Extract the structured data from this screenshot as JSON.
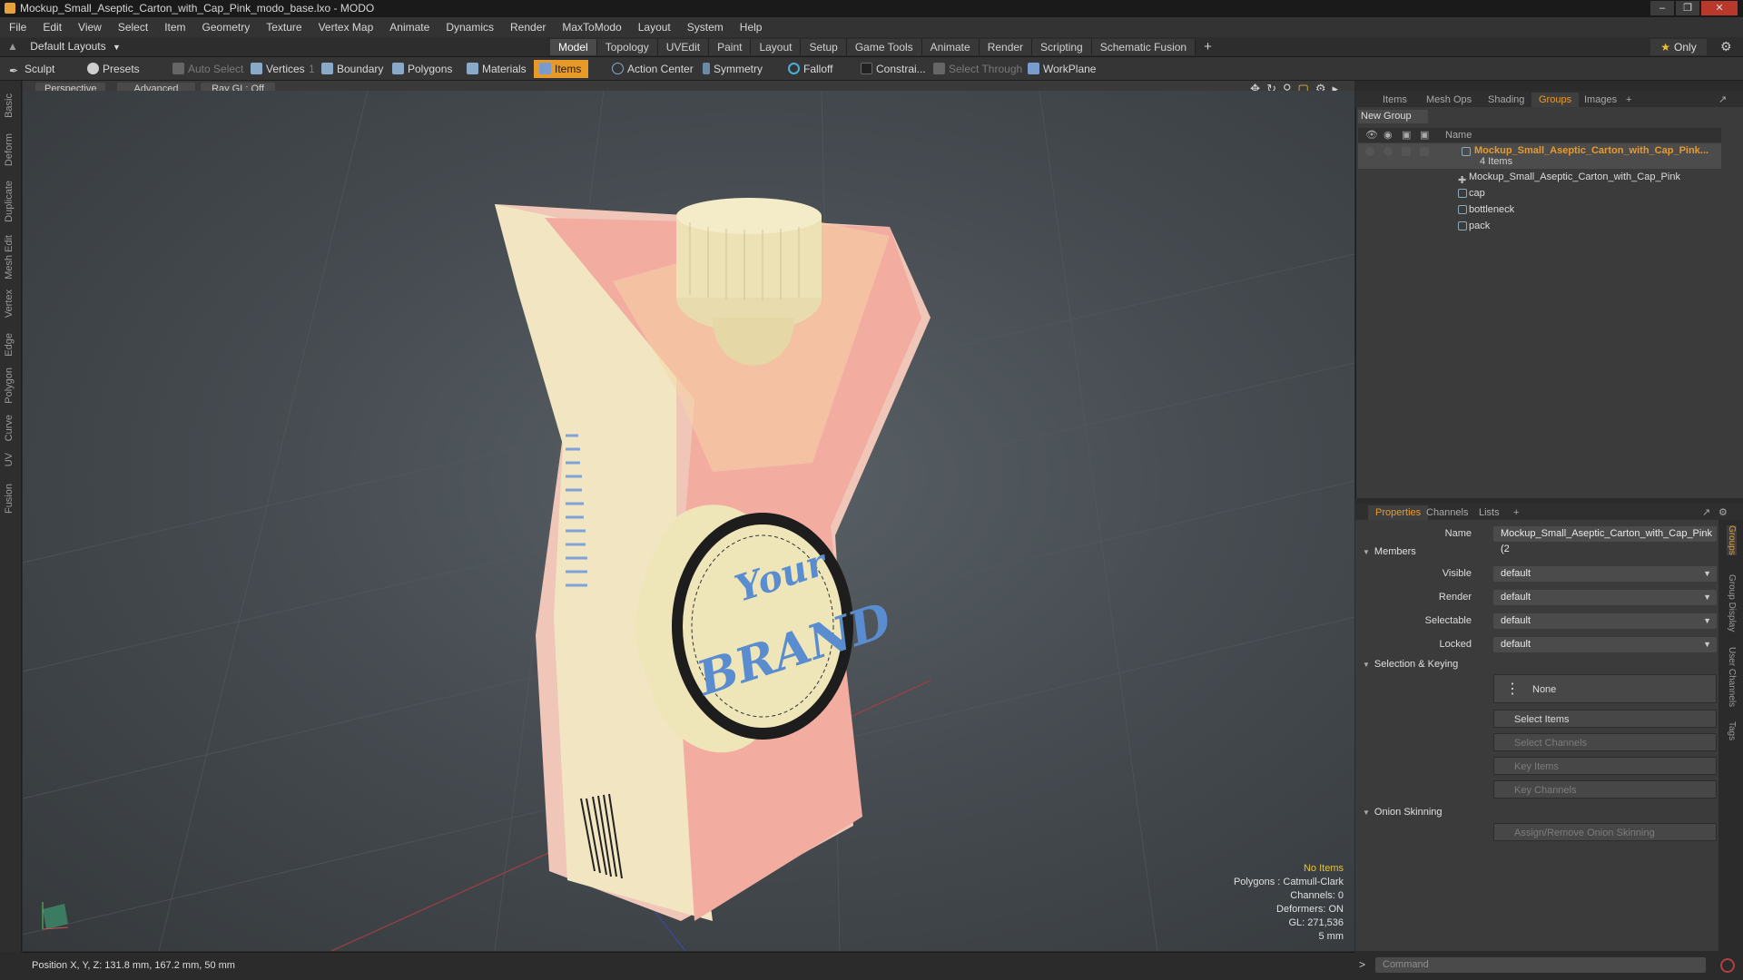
{
  "window": {
    "title": "Mockup_Small_Aseptic_Carton_with_Cap_Pink_modo_base.lxo - MODO"
  },
  "menu": [
    "File",
    "Edit",
    "View",
    "Select",
    "Item",
    "Geometry",
    "Texture",
    "Vertex Map",
    "Animate",
    "Dynamics",
    "Render",
    "MaxToModo",
    "Layout",
    "System",
    "Help"
  ],
  "layouts": {
    "label": "Default Layouts"
  },
  "workspace_tabs": [
    "Model",
    "Topology",
    "UVEdit",
    "Paint",
    "Layout",
    "Setup",
    "Game Tools",
    "Animate",
    "Render",
    "Scripting",
    "Schematic Fusion"
  ],
  "only_label": "Only",
  "toolbar": {
    "sculpt": "Sculpt",
    "presets": "Presets",
    "auto_select": "Auto Select",
    "vertices": "Vertices",
    "vertices_count": "1",
    "boundary": "Boundary",
    "polygons": "Polygons",
    "materials": "Materials",
    "items": "Items",
    "action_center": "Action Center",
    "symmetry": "Symmetry",
    "falloff": "Falloff",
    "constraints": "Constrai...",
    "select_through": "Select Through",
    "workplane": "WorkPlane"
  },
  "left_tabs": [
    "Basic",
    "Deform",
    "Duplicate",
    "Mesh Edit",
    "Vertex",
    "Edge",
    "Polygon",
    "Curve",
    "UV",
    "Fusion"
  ],
  "viewport": {
    "perspective": "Perspective",
    "advanced": "Advanced",
    "raygl": "Ray GL: Off",
    "brand_line1": "Your",
    "brand_line2": "BRAND",
    "stats": {
      "no_items": "No Items",
      "polygons": "Polygons : Catmull-Clark",
      "channels": "Channels: 0",
      "deformers": "Deformers: ON",
      "gl": "GL: 271,536",
      "scale": "5 mm"
    }
  },
  "status": {
    "position": "Position X, Y, Z:  131.8 mm, 167.2 mm, 50 mm"
  },
  "right_tabs": [
    "Items",
    "Mesh Ops",
    "Shading",
    "Groups",
    "Images"
  ],
  "groups": {
    "new_group": "New Group",
    "col_name": "Name",
    "root": {
      "name": "Mockup_Small_Aseptic_Carton_with_Cap_Pink...",
      "count": "4 Items"
    },
    "children": [
      "Mockup_Small_Aseptic_Carton_with_Cap_Pink",
      "cap",
      "bottleneck",
      "pack"
    ]
  },
  "props_tabs": [
    "Properties",
    "Channels",
    "Lists"
  ],
  "properties": {
    "name_label": "Name",
    "name_value": "Mockup_Small_Aseptic_Carton_with_Cap_Pink (2",
    "members": "Members",
    "visible_label": "Visible",
    "visible": "default",
    "render_label": "Render",
    "render": "default",
    "selectable_label": "Selectable",
    "selectable": "default",
    "locked_label": "Locked",
    "locked": "default",
    "selection_keying": "Selection & Keying",
    "none": "None",
    "select_items": "Select Items",
    "select_channels": "Select Channels",
    "key_items": "Key Items",
    "key_channels": "Key Channels",
    "onion": "Onion Skinning",
    "assign_onion": "Assign/Remove Onion Skinning"
  },
  "side_vtabs": [
    "Groups",
    "Group Display",
    "User Channels",
    "Tags"
  ],
  "command": {
    "placeholder": "Command",
    "prompt": ">"
  },
  "colors": {
    "accent": "#e89a2c",
    "items_active": "#e79a2a",
    "carton_pink": "#f3b4a8",
    "cream": "#eee6b8"
  }
}
